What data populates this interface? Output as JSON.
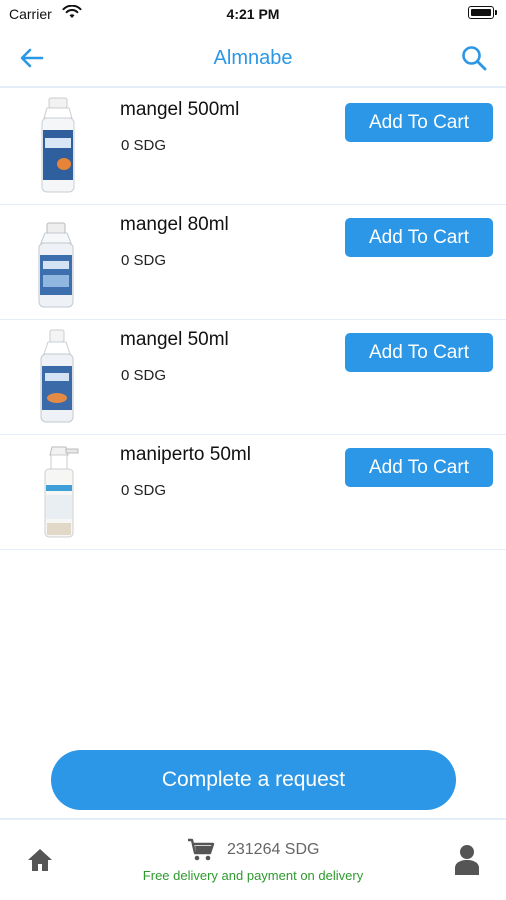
{
  "status_bar": {
    "carrier": "Carrier",
    "time": "4:21 PM"
  },
  "nav": {
    "title": "Almnabe"
  },
  "products": [
    {
      "name": "mangel 500ml",
      "price": "0 SDG",
      "button": "Add To Cart"
    },
    {
      "name": "mangel 80ml",
      "price": "0 SDG",
      "button": "Add To Cart"
    },
    {
      "name": "mangel 50ml",
      "price": "0 SDG",
      "button": "Add To Cart"
    },
    {
      "name": "maniperto 50ml",
      "price": "0 SDG",
      "button": "Add To Cart"
    }
  ],
  "complete_button": "Complete a request",
  "footer": {
    "cart_total": "231264 SDG",
    "delivery_note": "Free delivery and payment on delivery"
  },
  "colors": {
    "accent": "#2b97e6",
    "note": "#2e9a2e",
    "divider": "#e3eef8"
  },
  "icons": [
    "back-arrow-icon",
    "search-icon",
    "home-icon",
    "cart-icon",
    "user-icon",
    "wifi-icon",
    "battery-icon"
  ]
}
